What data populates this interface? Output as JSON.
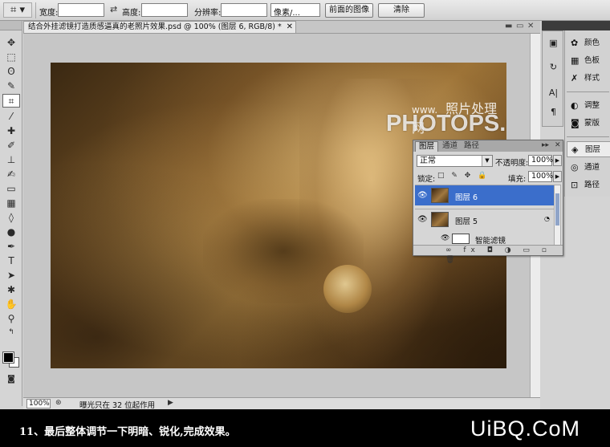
{
  "options_bar": {
    "width_label": "宽度:",
    "height_label": "高度:",
    "resolution_label": "分辨率:",
    "unit_select": "像素/...",
    "front_image_button": "前面的图像",
    "clear_button": "清除"
  },
  "document": {
    "tab_title": "结合外挂滤镜打造质感逼真的老照片效果.psd @ 100% (图层 6, RGB/8) *",
    "close_glyph": "✕",
    "zoom": "100%",
    "status_info": "曝光只在 32 位起作用",
    "watermark_small": "www.",
    "watermark_cn": "照片处理网",
    "watermark_big": "PHOTOPS.COM"
  },
  "layers_panel": {
    "tabs": [
      "图层",
      "通道",
      "路径"
    ],
    "blend_mode": "正常",
    "opacity_label": "不透明度:",
    "opacity_value": "100%",
    "lock_label": "锁定:",
    "fill_label": "填充:",
    "fill_value": "100%",
    "layers": [
      {
        "name": "图层 6",
        "selected": true
      },
      {
        "name": "图层 5",
        "selected": false
      }
    ],
    "smart_filter_label": "智能滤镜",
    "footer_icons": "∞ fx ◘ ◑ ▭ ▫ 🗑"
  },
  "dock": {
    "items": [
      "颜色",
      "色板",
      "样式",
      "调整",
      "蒙版",
      "图层",
      "通道",
      "路径"
    ],
    "selected": "图层"
  },
  "caption": {
    "text": "11、最后整体调节一下明暗、锐化,完成效果。",
    "brand": "UiBQ.CoM"
  },
  "colors": {
    "selection_blue": "#3b6ecb",
    "caption_bg": "#000000",
    "sepia_mid": "#9a7236"
  }
}
